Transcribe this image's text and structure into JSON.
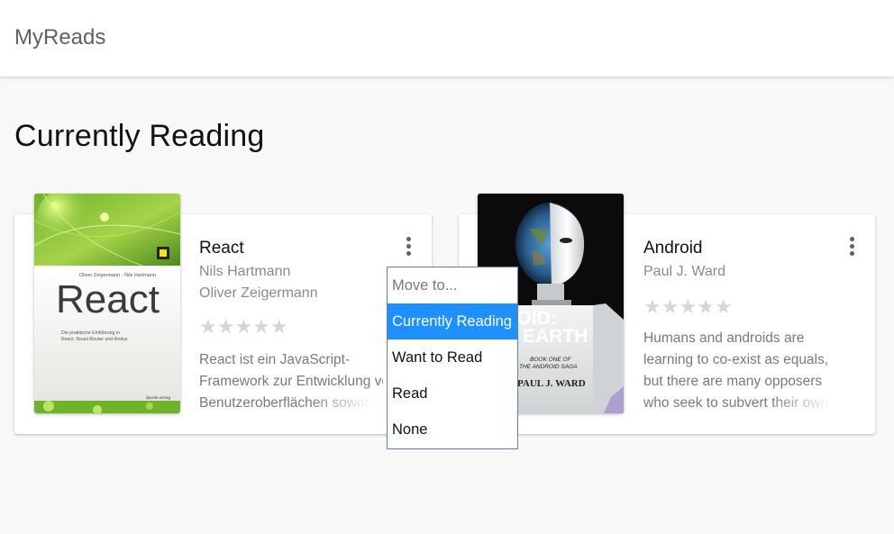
{
  "app": {
    "title": "MyReads"
  },
  "shelf": {
    "title": "Currently Reading"
  },
  "books": [
    {
      "title": "React",
      "authors": [
        "Nils Hartmann",
        "Oliver Zeigermann"
      ],
      "stars": "★★★★★",
      "description_lines": [
        "React ist ein JavaScript-",
        "Framework zur Entwicklung von",
        "Benutzeroberflächen sowohl"
      ],
      "cover": {
        "authors_line": "Oliver Zeigermann · Nils Hartmann",
        "title": "React",
        "subtitle_line1": "Die praktische Einführung in",
        "subtitle_line2": "React, React Router und Redux",
        "publisher": "dpunkt.verlag",
        "accent_color": "#8cc63f"
      }
    },
    {
      "title": "Android",
      "authors": [
        "Paul J. Ward"
      ],
      "stars": "★★★★★",
      "description_lines": [
        "Humans and androids are",
        "learning to co-exist as equals,",
        "but there are many opposers",
        "who seek to subvert their own"
      ],
      "cover": {
        "title_line1": "NDROID:",
        "title_line2": "EARTH",
        "series_line1": "BOOK ONE OF",
        "series_line2": "THE ANDROID SAGA",
        "author": "PAUL J. WARD"
      }
    }
  ],
  "shelf_menu": {
    "header": "Move to...",
    "options": [
      "Currently Reading",
      "Want to Read",
      "Read",
      "None"
    ],
    "selected": "Currently Reading",
    "selected_color": "#1e90ff"
  }
}
